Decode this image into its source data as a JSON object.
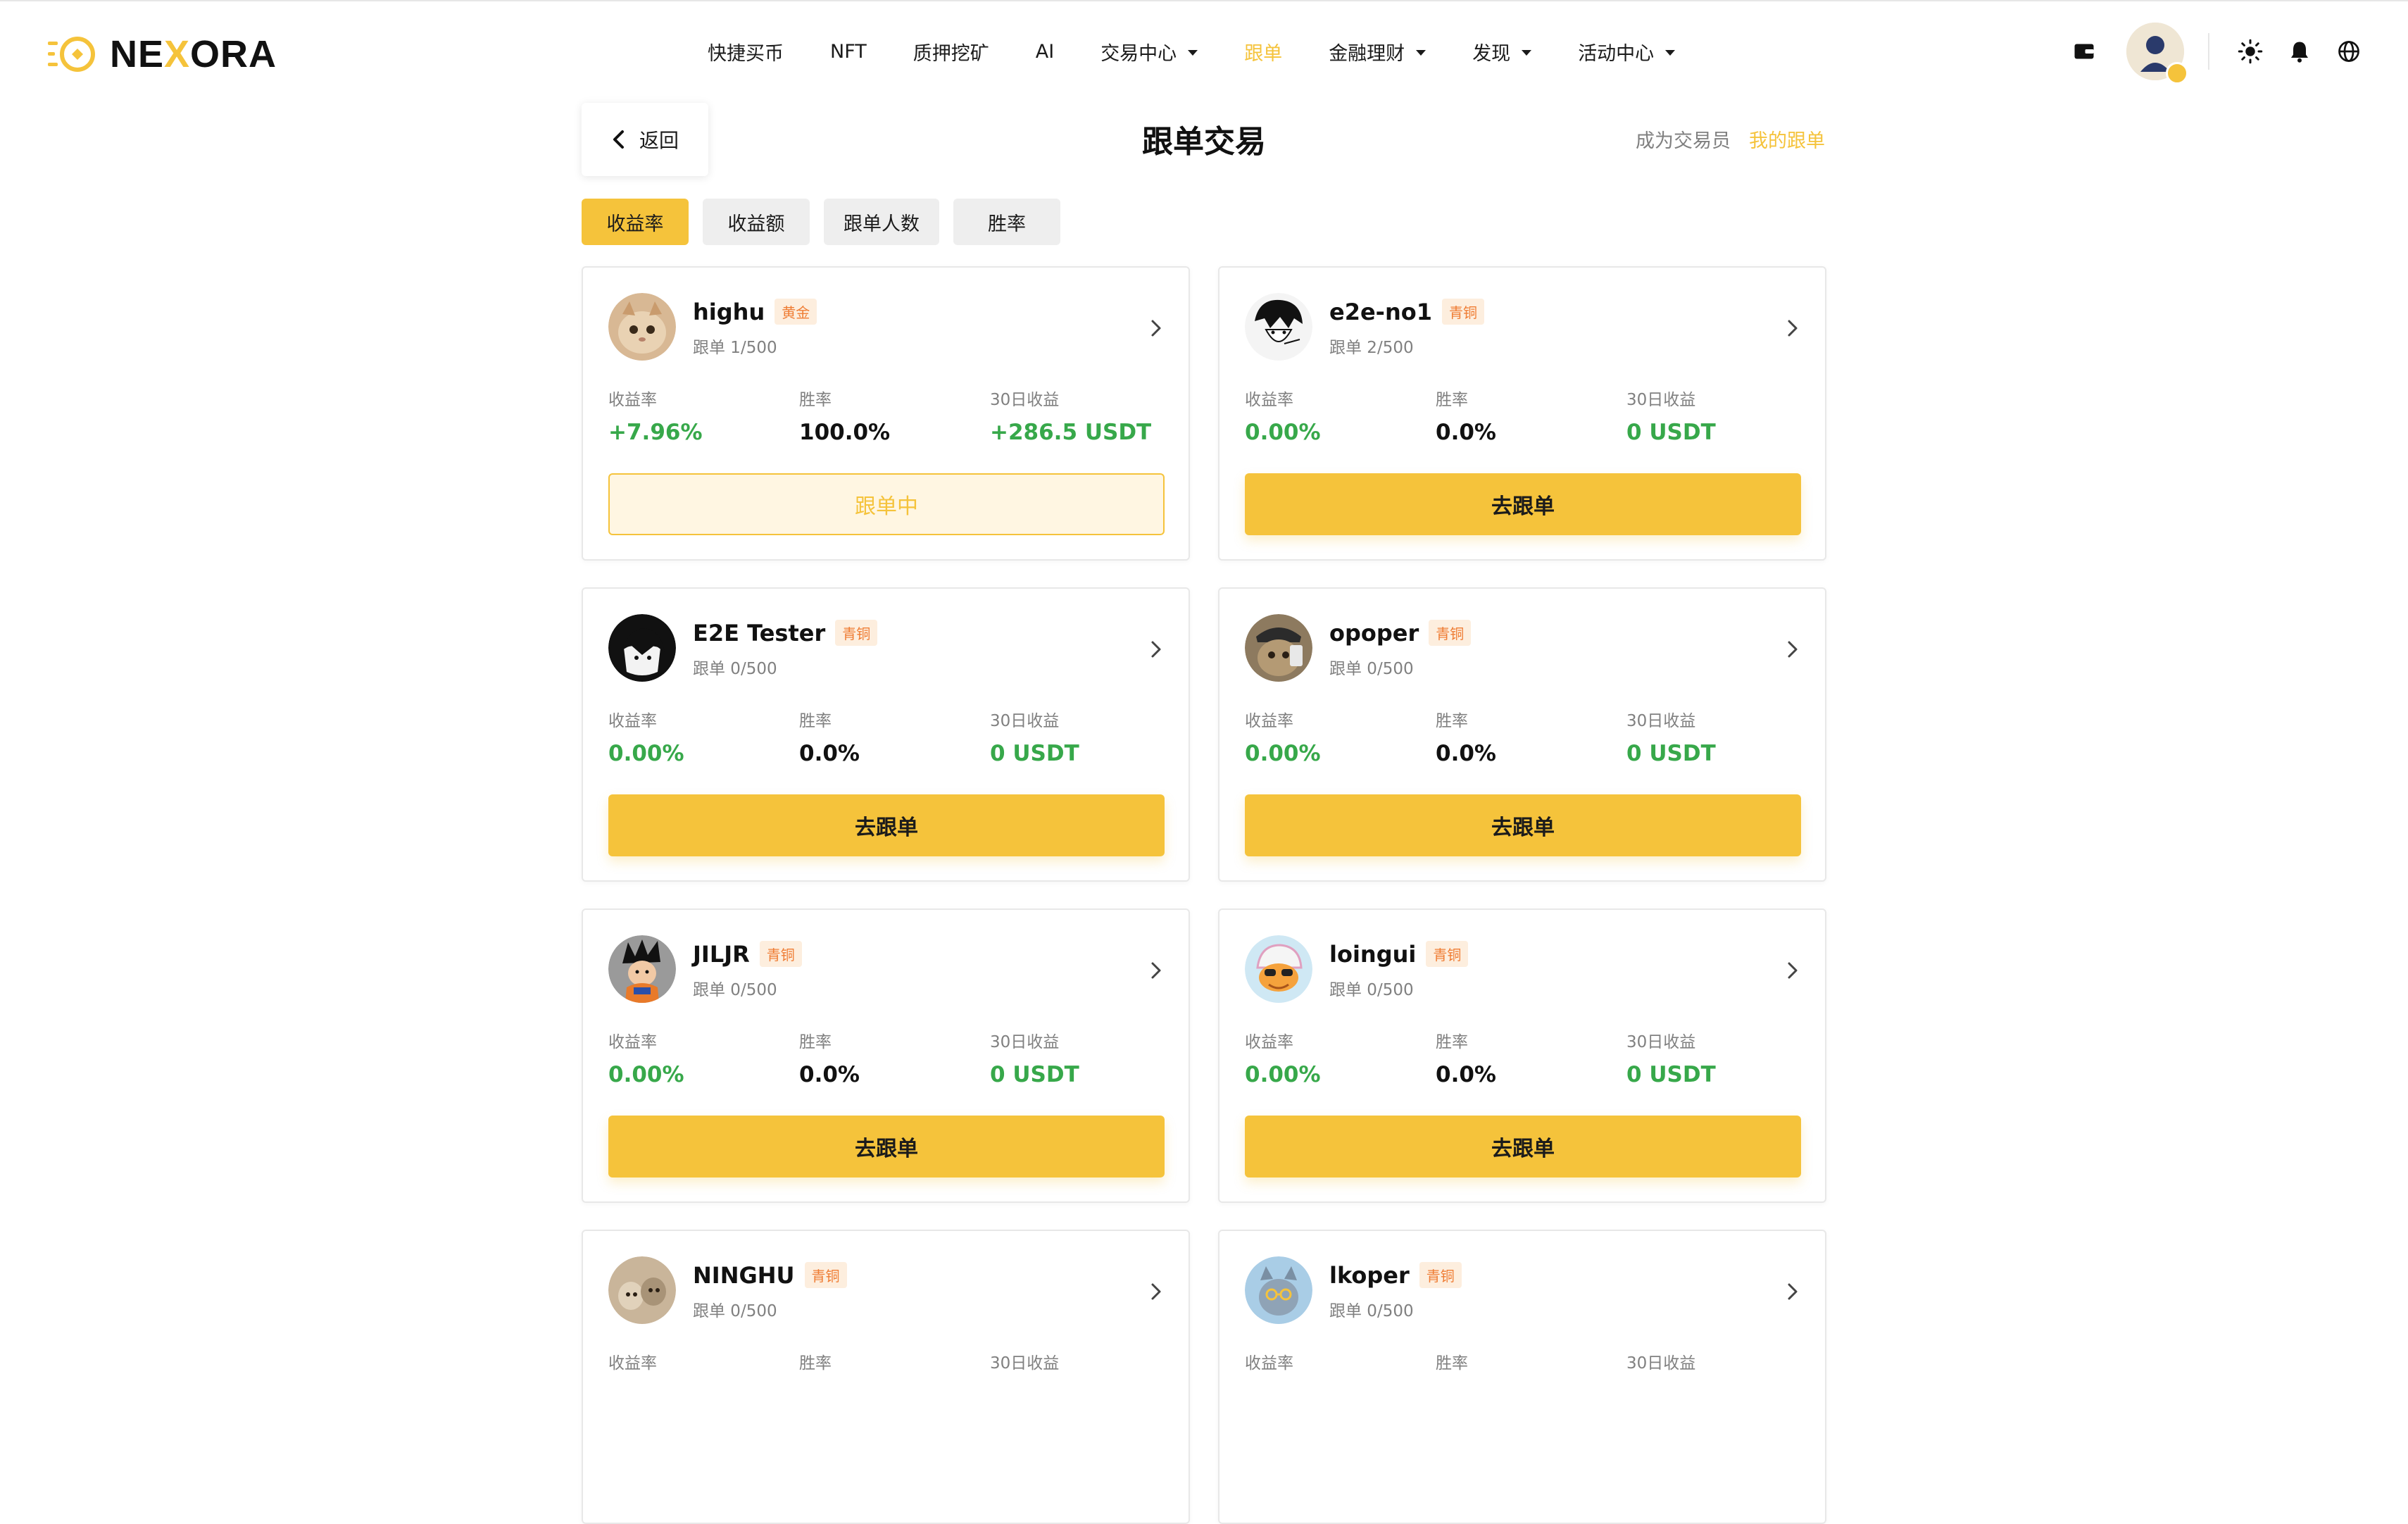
{
  "brand": {
    "name_part1": "NE",
    "name_accent": "X",
    "name_part2": "ORA",
    "accent_color": "#f5c33b"
  },
  "nav": {
    "items": [
      {
        "label": "快捷买币",
        "dropdown": false,
        "active": false
      },
      {
        "label": "NFT",
        "dropdown": false,
        "active": false
      },
      {
        "label": "质押挖矿",
        "dropdown": false,
        "active": false
      },
      {
        "label": "AI",
        "dropdown": false,
        "active": false
      },
      {
        "label": "交易中心",
        "dropdown": true,
        "active": false
      },
      {
        "label": "跟单",
        "dropdown": false,
        "active": true
      },
      {
        "label": "金融理财",
        "dropdown": true,
        "active": false
      },
      {
        "label": "发现",
        "dropdown": true,
        "active": false
      },
      {
        "label": "活动中心",
        "dropdown": true,
        "active": false
      }
    ],
    "right_icons": [
      "wallet-icon",
      "avatar",
      "sun-icon",
      "bell-icon",
      "globe-icon"
    ]
  },
  "header": {
    "back_label": "返回",
    "title": "跟单交易",
    "become_trader": "成为交易员",
    "my_follows": "我的跟单"
  },
  "tabs": [
    {
      "label": "收益率",
      "active": true
    },
    {
      "label": "收益额",
      "active": false
    },
    {
      "label": "跟单人数",
      "active": false
    },
    {
      "label": "胜率",
      "active": false
    }
  ],
  "stat_labels": {
    "rate": "收益率",
    "win": "胜率",
    "profit30": "30日收益"
  },
  "traders": [
    {
      "name": "highu",
      "tier": "黄金",
      "follow": "跟单 1/500",
      "rate": "+7.96%",
      "win": "100.0%",
      "profit30": "+286.5 USDT",
      "action": "跟单中",
      "following": true,
      "avatar": "cat-photo"
    },
    {
      "name": "e2e-no1",
      "tier": "青铜",
      "follow": "跟单 2/500",
      "rate": "0.00%",
      "win": "0.0%",
      "profit30": "0 USDT",
      "action": "去跟单",
      "following": false,
      "avatar": "anime-sketch"
    },
    {
      "name": "E2E Tester",
      "tier": "青铜",
      "follow": "跟单 0/500",
      "rate": "0.00%",
      "win": "0.0%",
      "profit30": "0 USDT",
      "action": "去跟单",
      "following": false,
      "avatar": "anime-dark"
    },
    {
      "name": "opoper",
      "tier": "青铜",
      "follow": "跟单 0/500",
      "rate": "0.00%",
      "win": "0.0%",
      "profit30": "0 USDT",
      "action": "去跟单",
      "following": false,
      "avatar": "cat-cap"
    },
    {
      "name": "JILJR",
      "tier": "青铜",
      "follow": "跟单 0/500",
      "rate": "0.00%",
      "win": "0.0%",
      "profit30": "0 USDT",
      "action": "去跟单",
      "following": false,
      "avatar": "anime-goku"
    },
    {
      "name": "loingui",
      "tier": "青铜",
      "follow": "跟单 0/500",
      "rate": "0.00%",
      "win": "0.0%",
      "profit30": "0 USDT",
      "action": "去跟单",
      "following": false,
      "avatar": "cartoon-duck"
    },
    {
      "name": "NINGHU",
      "tier": "青铜",
      "follow": "跟单 0/500",
      "rate": "",
      "win": "",
      "profit30": "",
      "action": "",
      "following": false,
      "avatar": "cats-photo"
    },
    {
      "name": "lkoper",
      "tier": "青铜",
      "follow": "跟单 0/500",
      "rate": "",
      "win": "",
      "profit30": "",
      "action": "",
      "following": false,
      "avatar": "cartoon-cat"
    }
  ]
}
